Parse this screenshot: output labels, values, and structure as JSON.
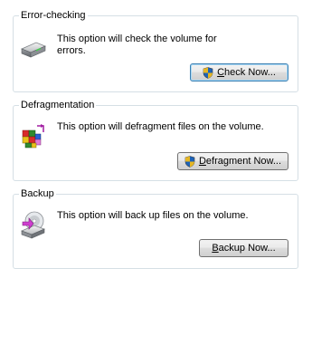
{
  "error_checking": {
    "title": "Error-checking",
    "description": "This option will check the volume for errors.",
    "button_label": "Check Now...",
    "icon": "hard-drive-icon"
  },
  "defragmentation": {
    "title": "Defragmentation",
    "description": "This option will defragment files on the volume.",
    "button_label": "Defragment Now...",
    "icon": "defragment-icon"
  },
  "backup": {
    "title": "Backup",
    "description": "This option will back up files on the volume.",
    "button_label": "Backup Now...",
    "icon": "backup-icon"
  },
  "colors": {
    "group_border": "#d5dfe5",
    "focus_border": "#3c7fb1"
  }
}
